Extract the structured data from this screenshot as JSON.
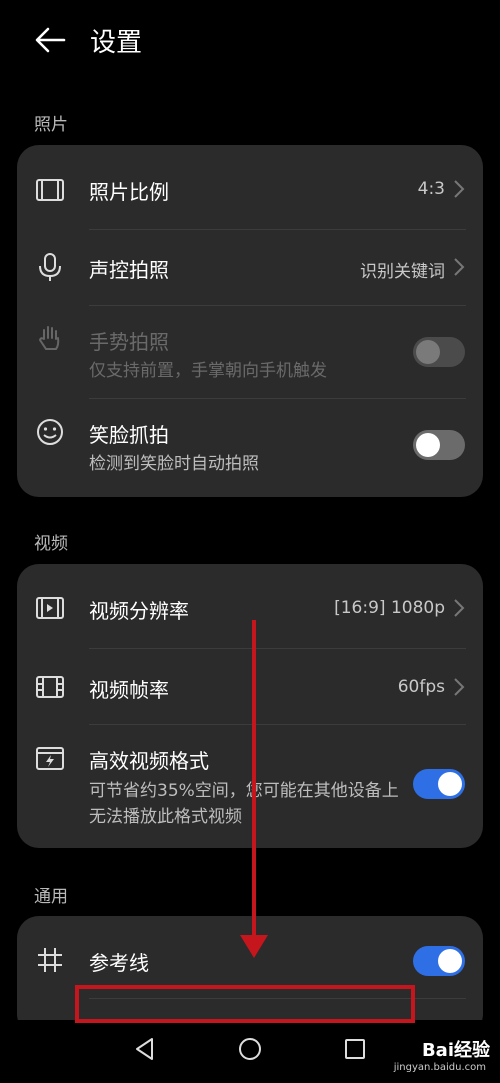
{
  "header": {
    "title": "设置"
  },
  "photo": {
    "section_label": "照片",
    "ratio": {
      "label": "照片比例",
      "value": "4:3"
    },
    "voice": {
      "label": "声控拍照",
      "value": "识别关键词"
    },
    "gesture": {
      "label": "手势拍照",
      "sub": "仅支持前置，手掌朝向手机触发",
      "enabled": false,
      "on": false
    },
    "smile": {
      "label": "笑脸抓拍",
      "sub": "检测到笑脸时自动拍照",
      "on": false
    }
  },
  "video": {
    "section_label": "视频",
    "resolution": {
      "label": "视频分辨率",
      "value": "[16:9] 1080p"
    },
    "fps": {
      "label": "视频帧率",
      "value": "60fps"
    },
    "hevc": {
      "label": "高效视频格式",
      "sub": "可节省约35%空间，您可能在其他设备上无法播放此格式视频",
      "on": true
    }
  },
  "general": {
    "section_label": "通用",
    "grid": {
      "label": "参考线",
      "on": true
    }
  },
  "watermark": {
    "text": "Bai经验",
    "sub": "jingyan.baidu.com"
  },
  "colors": {
    "toggle_on": "#2f6fe6",
    "card": "#2b2b2b",
    "annotation": "#c4161c"
  }
}
